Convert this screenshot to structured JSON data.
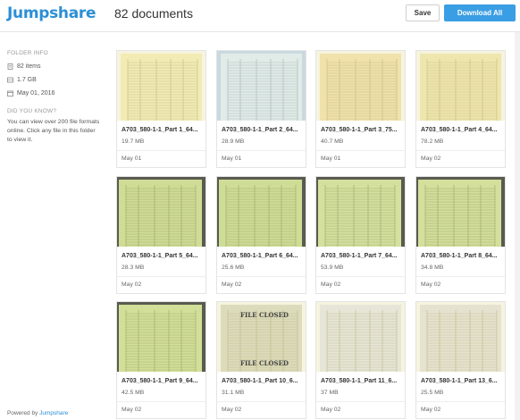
{
  "header": {
    "logo": "Jumpshare",
    "doc_count": "82 documents",
    "save_label": "Save",
    "download_label": "Download All",
    "accent": "#3a9ee4"
  },
  "sidebar": {
    "folder_info_heading": "FOLDER INFO",
    "items_count": "82 items",
    "size": "1.7 GB",
    "date": "May 01, 2016",
    "did_you_know_heading": "DID YOU KNOW?",
    "tip": "You can view over 200 file formats online. Click any file in this folder to view it.",
    "powered_prefix": "Powered by",
    "powered_brand": "Jumpshare"
  },
  "files": [
    {
      "name": "A703_580-1-1_Part 1_64...",
      "size": "19.7 MB",
      "date": "May 01",
      "tone": "#f2ebb4",
      "style": "ledger"
    },
    {
      "name": "A703_580-1-1_Part 2_64...",
      "size": "28.9 MB",
      "date": "May 01",
      "tone": "#e1ebe7",
      "style": "blue"
    },
    {
      "name": "A703_580-1-1_Part 3_75...",
      "size": "40.7 MB",
      "date": "May 01",
      "tone": "#f0e2aa",
      "style": "ledger"
    },
    {
      "name": "A703_580-1-1_Part 4_64...",
      "size": "78.2 MB",
      "date": "May 02",
      "tone": "#efe6ad",
      "style": "ledger"
    },
    {
      "name": "A703_580-1-1_Part 5_64...",
      "size": "28.3 MB",
      "date": "May 02",
      "tone": "#cfdc95",
      "style": "green"
    },
    {
      "name": "A703_580-1-1_Part 6_64...",
      "size": "25.6 MB",
      "date": "May 02",
      "tone": "#cedd96",
      "style": "green"
    },
    {
      "name": "A703_580-1-1_Part 7_64...",
      "size": "53.9 MB",
      "date": "May 02",
      "tone": "#d4e09e",
      "style": "green"
    },
    {
      "name": "A703_580-1-1_Part 8_64...",
      "size": "34.8 MB",
      "date": "May 02",
      "tone": "#d3df9b",
      "style": "green"
    },
    {
      "name": "A703_580-1-1_Part 9_64...",
      "size": "42.5 MB",
      "date": "May 02",
      "tone": "#d2df98",
      "style": "green"
    },
    {
      "name": "A703_580-1-1_Part 10_6...",
      "size": "31.1 MB",
      "date": "May 02",
      "tone": "#dcdcbc",
      "style": "closed"
    },
    {
      "name": "A703_580-1-1_Part 11_6...",
      "size": "37 MB",
      "date": "May 02",
      "tone": "#e6e6d8",
      "style": "pale"
    },
    {
      "name": "A703_580-1-1_Part 13_6...",
      "size": "25.5 MB",
      "date": "May 02",
      "tone": "#e5e3d0",
      "style": "pale"
    }
  ]
}
